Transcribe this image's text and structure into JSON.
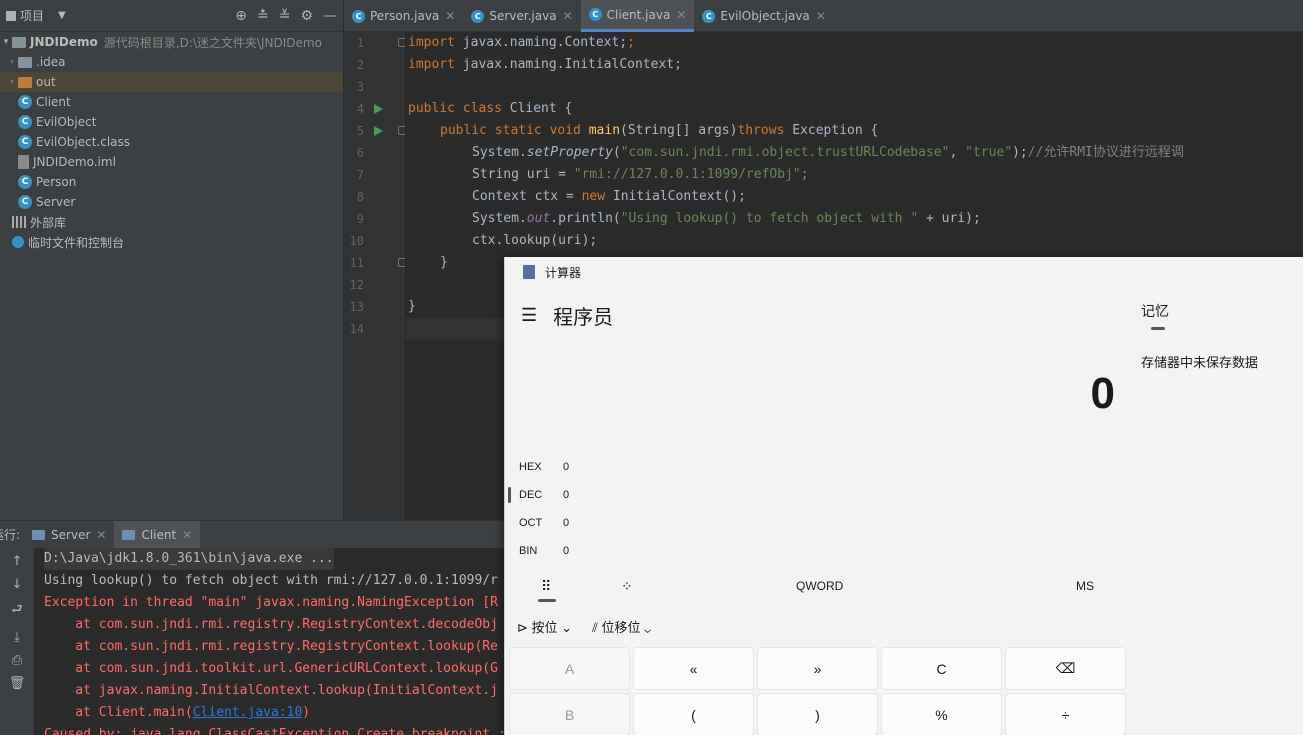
{
  "project": {
    "title": "项目",
    "tree": [
      {
        "label": "JNDIDemo",
        "sub": "源代码根目录,D:\\迷之文件夹\\JNDIDemo",
        "kind": "module",
        "arrow": "▾"
      },
      {
        "label": ".idea",
        "kind": "folder",
        "arrow": "›"
      },
      {
        "label": "out",
        "kind": "folder-orange",
        "arrow": "›"
      },
      {
        "label": "Client",
        "kind": "class"
      },
      {
        "label": "EvilObject",
        "kind": "class"
      },
      {
        "label": "EvilObject.class",
        "kind": "class"
      },
      {
        "label": "JNDIDemo.iml",
        "kind": "file"
      },
      {
        "label": "Person",
        "kind": "class"
      },
      {
        "label": "Server",
        "kind": "class"
      },
      {
        "label": "外部库",
        "kind": "library"
      },
      {
        "label": "临时文件和控制台",
        "kind": "scratch"
      }
    ]
  },
  "tabs": [
    {
      "label": "Person.java",
      "active": false
    },
    {
      "label": "Server.java",
      "active": false
    },
    {
      "label": "Client.java",
      "active": true
    },
    {
      "label": "EvilObject.java",
      "active": false
    }
  ],
  "code": {
    "line_numbers": [
      "1",
      "2",
      "3",
      "4",
      "5",
      "6",
      "7",
      "8",
      "9",
      "10",
      "11",
      "12",
      "13",
      "14"
    ],
    "l1": [
      "import",
      " javax.naming.Context;"
    ],
    "l2": [
      "import",
      " javax.naming.InitialContext;"
    ],
    "l4": [
      "public class",
      " Client {"
    ],
    "l5": [
      "public static void",
      "main",
      "(String[] args)",
      "throws",
      " Exception {"
    ],
    "l6": [
      "System.",
      "setProperty",
      "(",
      "\"com.sun.jndi.rmi.object.trustURLCodebase\"",
      ", ",
      "\"true\"",
      ");",
      "//允许RMI协议进行远程调"
    ],
    "l7": [
      "String uri = ",
      "\"rmi://127.0.0.1:1099/refObj\"",
      ";"
    ],
    "l8": [
      "Context ctx = ",
      "new",
      " InitialContext();"
    ],
    "l9": [
      "System.",
      "out",
      ".println(",
      "\"Using lookup() to fetch object with \"",
      " + uri);"
    ],
    "l10": [
      "ctx.lookup(uri);"
    ],
    "l11": [
      "}"
    ],
    "l13": [
      "}"
    ]
  },
  "run": {
    "label": "运行:",
    "tabs": [
      {
        "label": "Server"
      },
      {
        "label": "Client"
      }
    ],
    "console": [
      "D:\\Java\\jdk1.8.0_361\\bin\\java.exe ...",
      "Using lookup() to fetch object with rmi://127.0.0.1:1099/r",
      "Exception in thread \"main\" javax.naming.NamingException [R",
      "    at com.sun.jndi.rmi.registry.RegistryContext.decodeObj",
      "    at com.sun.jndi.rmi.registry.RegistryContext.lookup(Re",
      "    at com.sun.jndi.toolkit.url.GenericURLContext.lookup(G",
      "    at javax.naming.InitialContext.lookup(InitialContext.j",
      "    at Client.main(",
      "Caused by: java.lang.ClassCastException Create breakpoint : E"
    ],
    "client_link": "Client.java:10",
    "client_tail": ")"
  },
  "calculator": {
    "window_title": "计算器",
    "mode": "程序员",
    "display": "0",
    "radix": [
      {
        "label": "HEX",
        "value": "0"
      },
      {
        "label": "DEC",
        "value": "0"
      },
      {
        "label": "OCT",
        "value": "0"
      },
      {
        "label": "BIN",
        "value": "0"
      }
    ],
    "word_size": "QWORD",
    "ms_label": "MS",
    "bitwise_label": "按位",
    "shift_label": "位移位",
    "keys": [
      {
        "label": "A",
        "disabled": true
      },
      {
        "label": "«",
        "disabled": false
      },
      {
        "label": "»",
        "disabled": false
      },
      {
        "label": "C",
        "disabled": false
      },
      {
        "label": "⌫",
        "disabled": false
      },
      {
        "label": "B",
        "disabled": true
      },
      {
        "label": "(",
        "disabled": false
      },
      {
        "label": ")",
        "disabled": false
      },
      {
        "label": "%",
        "disabled": false
      },
      {
        "label": "÷",
        "disabled": false
      }
    ],
    "memory_title": "记忆",
    "memory_empty": "存储器中未保存数据"
  }
}
